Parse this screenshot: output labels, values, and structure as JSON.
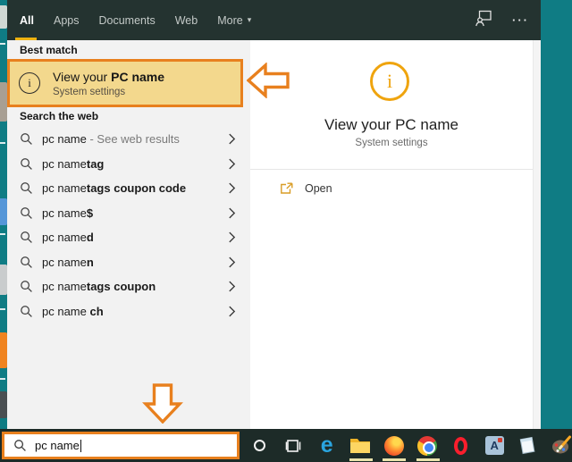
{
  "colors": {
    "desktop_teal": "#0f7c84",
    "header_bg": "#243330",
    "taskbar_bg": "#1d2b28",
    "panel_bg": "#f2f2f2",
    "best_match_highlight": "#f3d88d",
    "annotation_orange": "#e8801e",
    "active_tab_underline": "#eeb211",
    "info_icon_amber": "#efa40e"
  },
  "header": {
    "tabs": [
      {
        "label": "All",
        "active": true,
        "has_caret": false
      },
      {
        "label": "Apps",
        "active": false,
        "has_caret": false
      },
      {
        "label": "Documents",
        "active": false,
        "has_caret": false
      },
      {
        "label": "Web",
        "active": false,
        "has_caret": false
      },
      {
        "label": "More",
        "active": false,
        "has_caret": true
      }
    ],
    "more_options_glyph": "···"
  },
  "best_match": {
    "section_label": "Best match",
    "title_regular": "View your ",
    "title_bold": "PC name",
    "subtitle": "System settings"
  },
  "web_section": {
    "label": "Search the web",
    "items": [
      {
        "regular": "pc name",
        "bold": "",
        "note": " - See web results"
      },
      {
        "regular": "pc name",
        "bold": "tag",
        "note": ""
      },
      {
        "regular": "pc name",
        "bold": "tags coupon code",
        "note": ""
      },
      {
        "regular": "pc name",
        "bold": "$",
        "note": ""
      },
      {
        "regular": "pc name",
        "bold": "d",
        "note": ""
      },
      {
        "regular": "pc name",
        "bold": "n",
        "note": ""
      },
      {
        "regular": "pc name",
        "bold": "tags coupon",
        "note": ""
      },
      {
        "regular": "pc name ",
        "bold": "ch",
        "note": ""
      }
    ]
  },
  "preview": {
    "title": "View your PC name",
    "subtitle": "System settings",
    "open_label": "Open"
  },
  "search_box": {
    "value": "pc name"
  },
  "taskbar": {
    "icons": [
      {
        "name": "cortana",
        "active": false
      },
      {
        "name": "task-view",
        "active": false
      },
      {
        "name": "edge",
        "active": false
      },
      {
        "name": "file-explorer",
        "active": true
      },
      {
        "name": "firefox",
        "active": true
      },
      {
        "name": "chrome",
        "active": true
      },
      {
        "name": "opera",
        "active": false
      },
      {
        "name": "text-app",
        "active": false
      },
      {
        "name": "notepad",
        "active": false
      },
      {
        "name": "paint",
        "active": false
      }
    ]
  }
}
